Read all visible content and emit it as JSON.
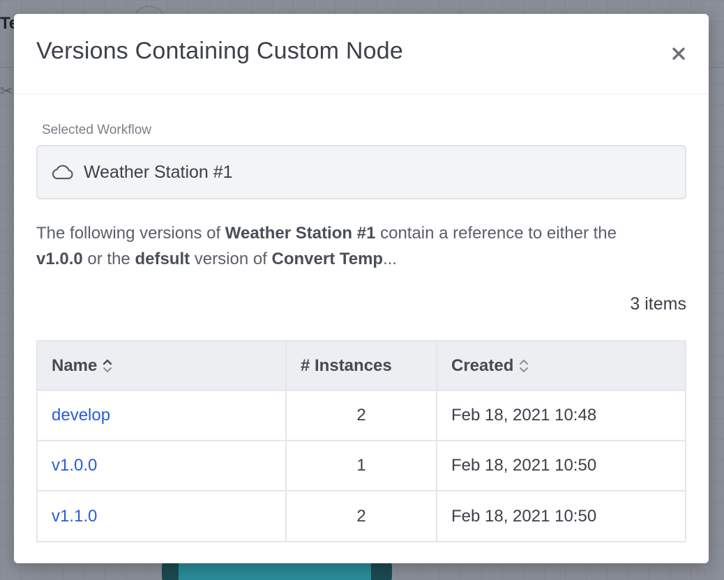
{
  "background": {
    "title_fragment": "Te"
  },
  "modal": {
    "title": "Versions Containing Custom Node",
    "close_icon": "close-icon",
    "selected_label": "Selected Workflow",
    "workflow_icon": "cloud-icon",
    "workflow_name": "Weather Station #1",
    "description": {
      "p1": "The following versions of ",
      "workflow": "Weather Station #1",
      "p2": " contain a reference to either the ",
      "version": "v1.0.0",
      "p3": " or the ",
      "alt_version": "defsult",
      "p4": " version of ",
      "node": "Convert Temp",
      "ellipsis": "..."
    },
    "item_count": "3 items",
    "table": {
      "columns": [
        {
          "label": "Name",
          "sortable": true
        },
        {
          "label": "# Instances",
          "sortable": false
        },
        {
          "label": "Created",
          "sortable": true
        }
      ],
      "rows": [
        {
          "name": "develop",
          "instances": "2",
          "created": "Feb 18, 2021 10:48"
        },
        {
          "name": "v1.0.0",
          "instances": "1",
          "created": "Feb 18, 2021 10:50"
        },
        {
          "name": "v1.1.0",
          "instances": "2",
          "created": "Feb 18, 2021 10:50"
        }
      ]
    }
  },
  "colors": {
    "link": "#2a5bd7",
    "title": "#3c404a",
    "overlay": "#8b8f99"
  }
}
